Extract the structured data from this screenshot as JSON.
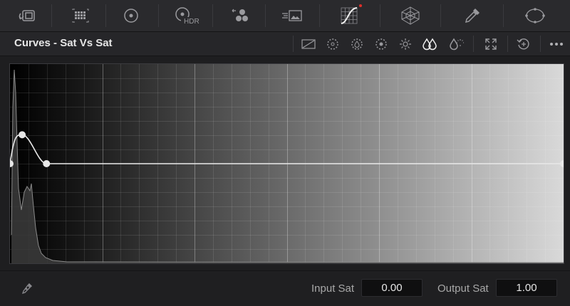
{
  "panel": {
    "title": "Curves - Sat Vs Sat"
  },
  "toolbar": {
    "tools": [
      {
        "name": "camera-raw-icon"
      },
      {
        "name": "color-match-icon"
      },
      {
        "name": "primaries-wheels-icon"
      },
      {
        "name": "hdr-wheels-icon",
        "label": "HDR"
      },
      {
        "name": "rgb-mixer-icon"
      },
      {
        "name": "motion-effects-icon"
      },
      {
        "name": "curves-icon",
        "active": true
      },
      {
        "name": "color-warper-icon"
      },
      {
        "name": "qualifier-icon"
      },
      {
        "name": "window-icon"
      }
    ]
  },
  "curve": {
    "points": [
      {
        "input": 0.0,
        "output": 1.0
      },
      {
        "input": 0.022,
        "output": 1.29
      },
      {
        "input": 0.066,
        "output": 1.0
      },
      {
        "input": 1.0,
        "output": 1.0
      }
    ]
  },
  "footer": {
    "input_label": "Input Sat",
    "input_value": "0.00",
    "output_label": "Output Sat",
    "output_value": "1.00"
  },
  "colors": {
    "background": "#1e1e20",
    "accent_dot": "#e0302a",
    "curve": "#e8e8e8"
  }
}
